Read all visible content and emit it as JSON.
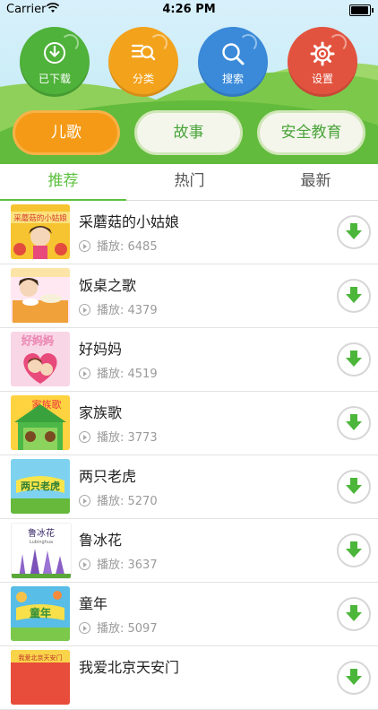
{
  "status_bar": {
    "carrier": "Carrier",
    "time": "4:26 PM"
  },
  "top_actions": [
    {
      "label": "已下载",
      "icon": "download-icon",
      "color": "#4fb23a"
    },
    {
      "label": "分类",
      "icon": "category-list-icon",
      "color": "#f3a21c"
    },
    {
      "label": "搜索",
      "icon": "search-icon",
      "color": "#3a8ad9"
    },
    {
      "label": "设置",
      "icon": "gear-icon",
      "color": "#e2533f"
    }
  ],
  "categories": [
    {
      "label": "儿歌",
      "selected": true
    },
    {
      "label": "故事",
      "selected": false
    },
    {
      "label": "安全教育",
      "selected": false
    }
  ],
  "tabs": [
    {
      "label": "推荐",
      "active": true
    },
    {
      "label": "热门",
      "active": false
    },
    {
      "label": "最新",
      "active": false
    }
  ],
  "songs": [
    {
      "title": "采蘑菇的小姑娘",
      "plays_label": "播放: 6485",
      "thumb_text": "采蘑菇的小姑娘"
    },
    {
      "title": "饭桌之歌",
      "plays_label": "播放: 4379",
      "thumb_text": ""
    },
    {
      "title": "好妈妈",
      "plays_label": "播放: 4519",
      "thumb_text": "好妈妈"
    },
    {
      "title": "家族歌",
      "plays_label": "播放: 3773",
      "thumb_text": "家族歌"
    },
    {
      "title": "两只老虎",
      "plays_label": "播放: 5270",
      "thumb_text": "两只老虎"
    },
    {
      "title": "鲁冰花",
      "plays_label": "播放: 3637",
      "thumb_text": "鲁冰花",
      "thumb_subtext": "Lubinghua"
    },
    {
      "title": "童年",
      "plays_label": "播放: 5097",
      "thumb_text": "童年"
    },
    {
      "title": "我爱北京天安门",
      "plays_label": "",
      "thumb_text": "我爱北京天安门"
    }
  ],
  "colors": {
    "accent_green": "#5cc13f",
    "accent_orange": "#f59a16"
  }
}
